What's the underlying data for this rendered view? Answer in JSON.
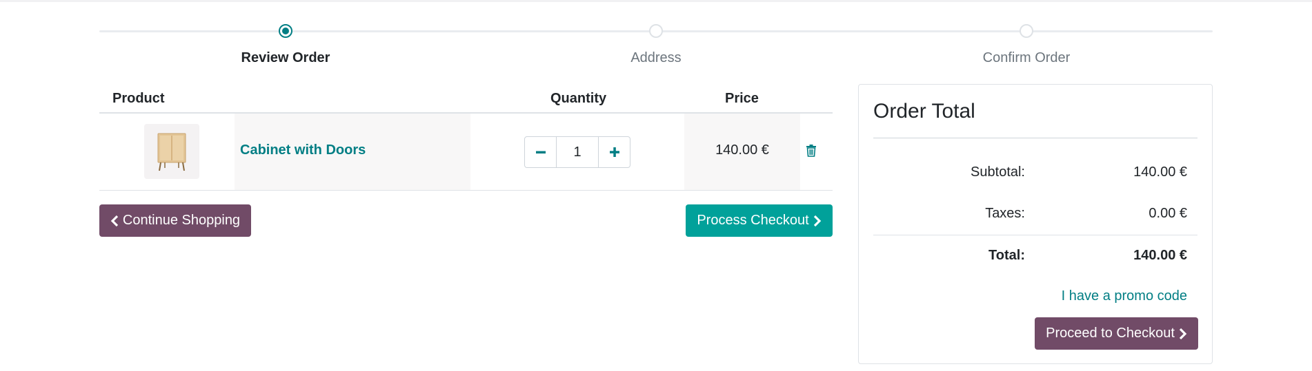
{
  "wizard": {
    "steps": [
      {
        "label": "Review Order",
        "active": true
      },
      {
        "label": "Address",
        "active": false
      },
      {
        "label": "Confirm Order",
        "active": false
      }
    ]
  },
  "cart": {
    "columns": {
      "product": "Product",
      "quantity": "Quantity",
      "price": "Price"
    },
    "items": [
      {
        "name": "Cabinet with Doors",
        "quantity": "1",
        "price": "140.00 €",
        "image_icon": "cabinet-image"
      }
    ],
    "continue_label": "Continue Shopping",
    "process_label": "Process Checkout"
  },
  "summary": {
    "title": "Order Total",
    "subtotal_label": "Subtotal:",
    "subtotal_value": "140.00 €",
    "taxes_label": "Taxes:",
    "taxes_value": "0.00 €",
    "total_label": "Total:",
    "total_value": "140.00 €",
    "promo_label": "I have a promo code",
    "proceed_label": "Proceed to Checkout"
  },
  "colors": {
    "primary": "#714b67",
    "accent": "#017e84",
    "checkout": "#01a19a"
  }
}
